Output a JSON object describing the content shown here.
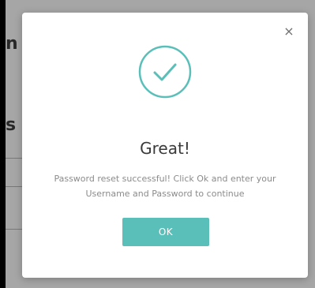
{
  "background": {
    "heading_fragment_1": "n",
    "heading_fragment_2": "s"
  },
  "modal": {
    "close_label": "×",
    "icon": "check-circle-icon",
    "title": "Great!",
    "message_line_1": "Password reset successful! Click Ok and enter your",
    "message_line_2": "Username and Password to continue",
    "ok_label": "OK",
    "accent_color": "#5bbfb9"
  }
}
